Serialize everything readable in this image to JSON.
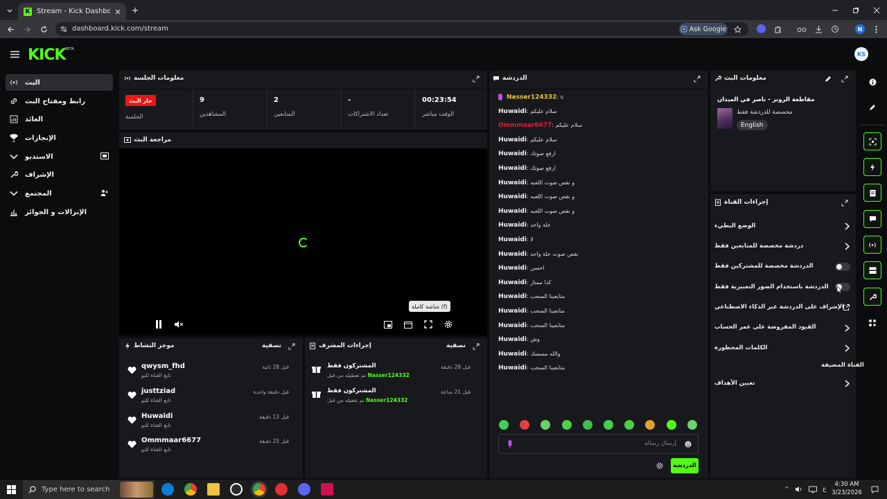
{
  "browser": {
    "tab_title": "Stream - Kick Dashboard",
    "url": "dashboard.kick.com/stream",
    "ask_google": "Ask Google",
    "profile_initial": "N"
  },
  "header": {
    "logo": "KICK",
    "beta": "BETA",
    "avatar_initials": "KS"
  },
  "sidebar": {
    "items": [
      {
        "label": "البث"
      },
      {
        "label": "رابط ومفتاح البث"
      },
      {
        "label": "العائد"
      },
      {
        "label": "الإنجازات"
      },
      {
        "label": "الاستديو"
      },
      {
        "label": "الإشراف"
      },
      {
        "label": "المجتمع"
      },
      {
        "label": "الإنزالات و الجوائز"
      }
    ]
  },
  "session": {
    "title": "معلومات الجلسة",
    "badge": "جار البث",
    "badge_label": "الجلسة",
    "viewers_value": "9",
    "viewers_label": "المشاهدين",
    "followers_value": "2",
    "followers_label": "المتابعين",
    "subs_value": "-",
    "subs_label": "تعداد الاشتراكات",
    "time_value": "00:23:54",
    "time_label": "الوقت مباشر"
  },
  "preview": {
    "title": "مراجعة البث",
    "tooltip": "شاشة كاملة (f)"
  },
  "activity": {
    "title": "موجز النشاط",
    "filter": "تصفية",
    "items": [
      {
        "name": "qwysm_fhd",
        "sub": "تابع القناة للتو",
        "time": "قبل 28 ثانية"
      },
      {
        "name": "justtziad",
        "sub": "تابع القناة للتو",
        "time": "قبل دقيقة واحدة"
      },
      {
        "name": "Huwaidi",
        "sub": "تابع القناة للتو",
        "time": "قبل 13 دقيقة"
      },
      {
        "name": "Ommmaar6677",
        "sub": "تابع القناة للتو",
        "time": "قبل 25 دقيقة"
      }
    ]
  },
  "mod_actions": {
    "title": "إجراءات المشرف",
    "filter": "تصفية",
    "items": [
      {
        "title": "المشتركون فقط",
        "desc": "تم تعطيله من قبل",
        "user": "Nasser124332",
        "time": "قبل 28 دقيقة"
      },
      {
        "title": "المشتركون فقط",
        "desc": "تم تفعيله من قبل",
        "user": "Nasser124332",
        "time": "قبل 21 ساعة"
      }
    ]
  },
  "chat": {
    "title": "الدردشة",
    "messages": [
      {
        "user": "Nasser124332",
        "text": "s",
        "color": "#e8c547",
        "mic": true
      },
      {
        "user": "Huwaidi",
        "text": "سلام عليكم",
        "color": "#f2f2f2"
      },
      {
        "user": "Ommmaar6677",
        "text": "سلام عليكم",
        "color": "#d9213f"
      },
      {
        "user": "Huwaidi",
        "text": "سلام عليكم",
        "color": "#f2f2f2"
      },
      {
        "user": "Huwaidi",
        "text": "ارفع صوتك",
        "color": "#f2f2f2"
      },
      {
        "user": "Huwaidi",
        "text": "ارفع صوتك",
        "color": "#f2f2f2"
      },
      {
        "user": "Huwaidi",
        "text": "و نقص صوت اللعبه",
        "color": "#f2f2f2"
      },
      {
        "user": "Huwaidi",
        "text": "و نقص صوت اللعبه",
        "color": "#f2f2f2"
      },
      {
        "user": "Huwaidi",
        "text": "و نقص صوت اللعبه",
        "color": "#f2f2f2"
      },
      {
        "user": "Huwaidi",
        "text": "خلة واحد",
        "color": "#f2f2f2"
      },
      {
        "user": "Huwaidi",
        "text": "لا",
        "color": "#f2f2f2"
      },
      {
        "user": "Huwaidi",
        "text": "نقص صوت خلة واحد",
        "color": "#f2f2f2"
      },
      {
        "user": "Huwaidi",
        "text": "احسن",
        "color": "#f2f2f2"
      },
      {
        "user": "Huwaidi",
        "text": "كذا ممتاز",
        "color": "#f2f2f2"
      },
      {
        "user": "Huwaidi",
        "text": "متابعينا السحب",
        "color": "#f2f2f2"
      },
      {
        "user": "Huwaidi",
        "text": "متابعينا السحب",
        "color": "#f2f2f2"
      },
      {
        "user": "Huwaidi",
        "text": "متابعينا السحب",
        "color": "#f2f2f2"
      },
      {
        "user": "Huwaidi",
        "text": "وش",
        "color": "#f2f2f2"
      },
      {
        "user": "Huwaidi",
        "text": "والله مسسك",
        "color": "#f2f2f2"
      },
      {
        "user": "Huwaidi",
        "text": "متابعينا السحب",
        "color": "#f2f2f2"
      }
    ],
    "input_placeholder": "إرسال رسالة",
    "send_label": "الدردشة"
  },
  "stream_info": {
    "title": "معلومات البث",
    "stream_title": "مقاطعة الرونز - ناصر في الميدان",
    "subtitle": "مخصصة للدردشة فقط",
    "language": "English"
  },
  "channel_actions": {
    "title": "إجراءات القناة",
    "items": [
      {
        "label": "الوضع البطيء",
        "kind": "chevron"
      },
      {
        "label": "دردشة مخصصة للمتابعين فقط",
        "kind": "chevron"
      },
      {
        "label": "الدردشة مخصصة للمشتركين فقط",
        "kind": "toggle"
      },
      {
        "label": "الدردشة باستخدام الصور التعبيرية فقط",
        "kind": "toggle"
      },
      {
        "label": "الإشراف على الدردشة عبر الذكاء الاصطناعي",
        "kind": "external"
      },
      {
        "label": "القيود المفروضة على عمر الحساب",
        "kind": "chevron"
      },
      {
        "label": "الكلمات المحظورة",
        "kind": "chevron"
      }
    ],
    "target_section": "القناة المضيفة",
    "target_label": "تعيين الأهداف"
  },
  "taskbar": {
    "search_placeholder": "Type here to search",
    "time": "4:30 AM",
    "date": "3/23/2026",
    "lang": "ع"
  }
}
